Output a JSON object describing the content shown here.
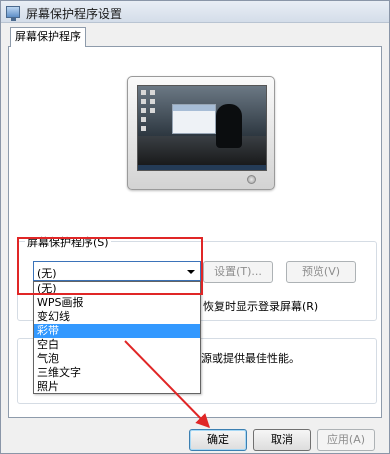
{
  "window": {
    "title": "屏幕保护程序设置"
  },
  "tabs": [
    {
      "label": "屏幕保护程序"
    }
  ],
  "screensaver": {
    "group_label": "屏幕保护程序(S)",
    "selected": "(无)",
    "settings_label": "设置(T)...",
    "preview_label": "预览(V)",
    "resume_text": "恢复时显示登录屏幕(R)",
    "options": [
      "(无)",
      "WPS画报",
      "变幻线",
      "彩带",
      "空白",
      "气泡",
      "三维文字",
      "照片"
    ],
    "highlighted_option": "彩带"
  },
  "power": {
    "partial_text": "省能源或提供最佳性能。"
  },
  "footer": {
    "ok_label": "确定",
    "cancel_label": "取消",
    "apply_label": "应用(A)"
  },
  "annotation": {
    "color": "#e02626"
  }
}
